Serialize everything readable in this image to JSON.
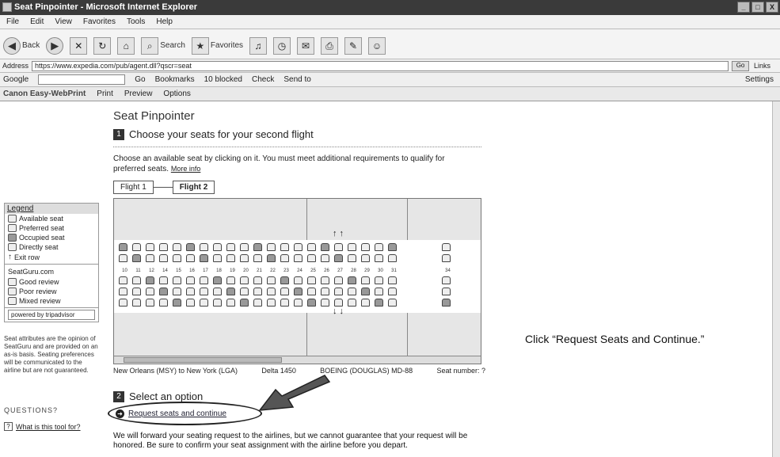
{
  "window": {
    "title": "Seat Pinpointer - Microsoft Internet Explorer",
    "controls": [
      "_",
      "□",
      "X"
    ]
  },
  "menu": [
    "File",
    "Edit",
    "View",
    "Favorites",
    "Tools",
    "Help"
  ],
  "toolbar": {
    "back": "Back",
    "search": "Search",
    "favorites": "Favorites"
  },
  "address": {
    "label": "Address",
    "url": "https://www.expedia.com/pub/agent.dll?qscr=seat",
    "go": "Go",
    "links": "Links"
  },
  "googlebar": {
    "label": "Google",
    "search_btn": "Go",
    "bookmarks": "Bookmarks",
    "blocked": "10 blocked",
    "check": "Check",
    "send": "Send to",
    "settings": "Settings"
  },
  "canonbar": {
    "brand": "Canon Easy-WebPrint",
    "print": "Print",
    "preview": "Preview",
    "options": "Options"
  },
  "page": {
    "title": "Seat Pinpointer",
    "step1_num": "1",
    "step1_title": "Choose your seats for your second flight",
    "instructions": "Choose an available seat by clicking on it. You must meet additional requirements to qualify for preferred seats.",
    "more_info": "More info",
    "flight_tabs": [
      "Flight 1",
      "Flight 2"
    ],
    "flight_info": {
      "route": "New Orleans (MSY) to New York (LGA)",
      "flight": "Delta 1450",
      "aircraft": "BOEING (DOUGLAS) MD-88",
      "seat": "Seat number: ?"
    },
    "step2_num": "2",
    "step2_title": "Select an option",
    "request_link": "Request seats and continue",
    "bottom_note": "We will forward your seating request to the airlines, but we cannot guarantee that your request will be honored. Be sure to confirm your seat assignment with the airline before you depart.",
    "row_numbers": [
      "10",
      "11",
      "12",
      "14",
      "15",
      "16",
      "17",
      "18",
      "19",
      "20",
      "21",
      "22",
      "23",
      "24",
      "25",
      "26",
      "27",
      "28",
      "29",
      "30",
      "31",
      "",
      "",
      "",
      "34"
    ]
  },
  "legend": {
    "title": "Legend",
    "items": [
      "Available seat",
      "Preferred seat",
      "Occupied seat",
      "Directly seat",
      "Exit row"
    ],
    "brand": "SeatGuru.com",
    "reviews": [
      "Good review",
      "Poor review",
      "Mixed review"
    ],
    "powered": "powered by tripadvisor"
  },
  "disclaimer": {
    "text": "Seat attributes are the opinion of SeatGuru and are provided on an as-is basis. Seating preferences will be communicated to the airline but are not guaranteed."
  },
  "questions": {
    "heading": "QUESTIONS?",
    "link": "What is this tool for?"
  },
  "callout": "Click “Request Seats and Continue.”"
}
